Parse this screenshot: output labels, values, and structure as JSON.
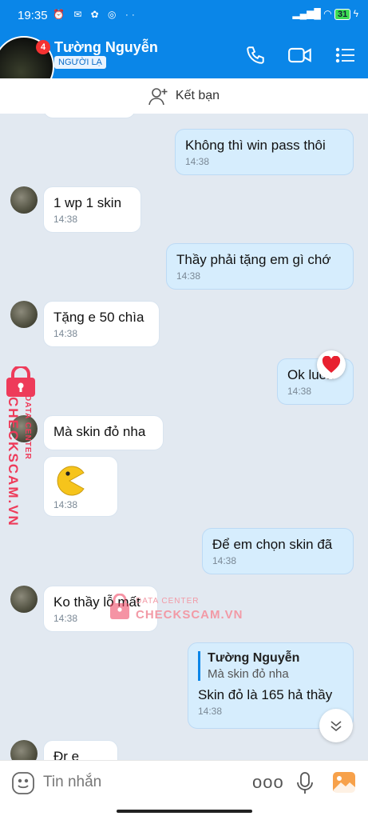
{
  "status_bar": {
    "time": "19:35",
    "battery": "31"
  },
  "header": {
    "notification_count": "4",
    "contact_name": "Tường Nguyễn",
    "stranger_badge": "NGƯỜI LẠ"
  },
  "add_friend": {
    "label": "Kết bạn"
  },
  "messages": [
    {
      "text": "Không thì win pass thôi",
      "time": "14:38"
    },
    {
      "text": "1 wp 1 skin",
      "time": "14:38"
    },
    {
      "text": "Thầy phải tặng em gì chớ",
      "time": "14:38"
    },
    {
      "text": "Tặng e 50 chìa",
      "time": "14:38"
    },
    {
      "text": "Ok luôn",
      "time": "14:38"
    },
    {
      "text": "Mà skin đỏ nha",
      "time": ""
    },
    {
      "text": "",
      "time": "14:38"
    },
    {
      "text": "Để em chọn skin đã",
      "time": "14:38"
    },
    {
      "text": "Ko thầy lỗ mất",
      "time": "14:38"
    },
    {
      "text": "Skin đỏ là 165 hả thầy",
      "time": "14:38",
      "quote": {
        "name": "Tường Nguyễn",
        "text": "Mà skin đỏ nha"
      }
    },
    {
      "text": "Đr e",
      "time": ""
    }
  ],
  "watermark": {
    "line1": "DATA CENTER",
    "line2": "CHECKSCAM.VN"
  },
  "input": {
    "placeholder": "Tin nhắn",
    "more_label": "ooo"
  },
  "colors": {
    "header": "#0a86e8",
    "outgoing": "#d6edfd",
    "incoming": "#ffffff",
    "background": "#e2e9f1"
  }
}
